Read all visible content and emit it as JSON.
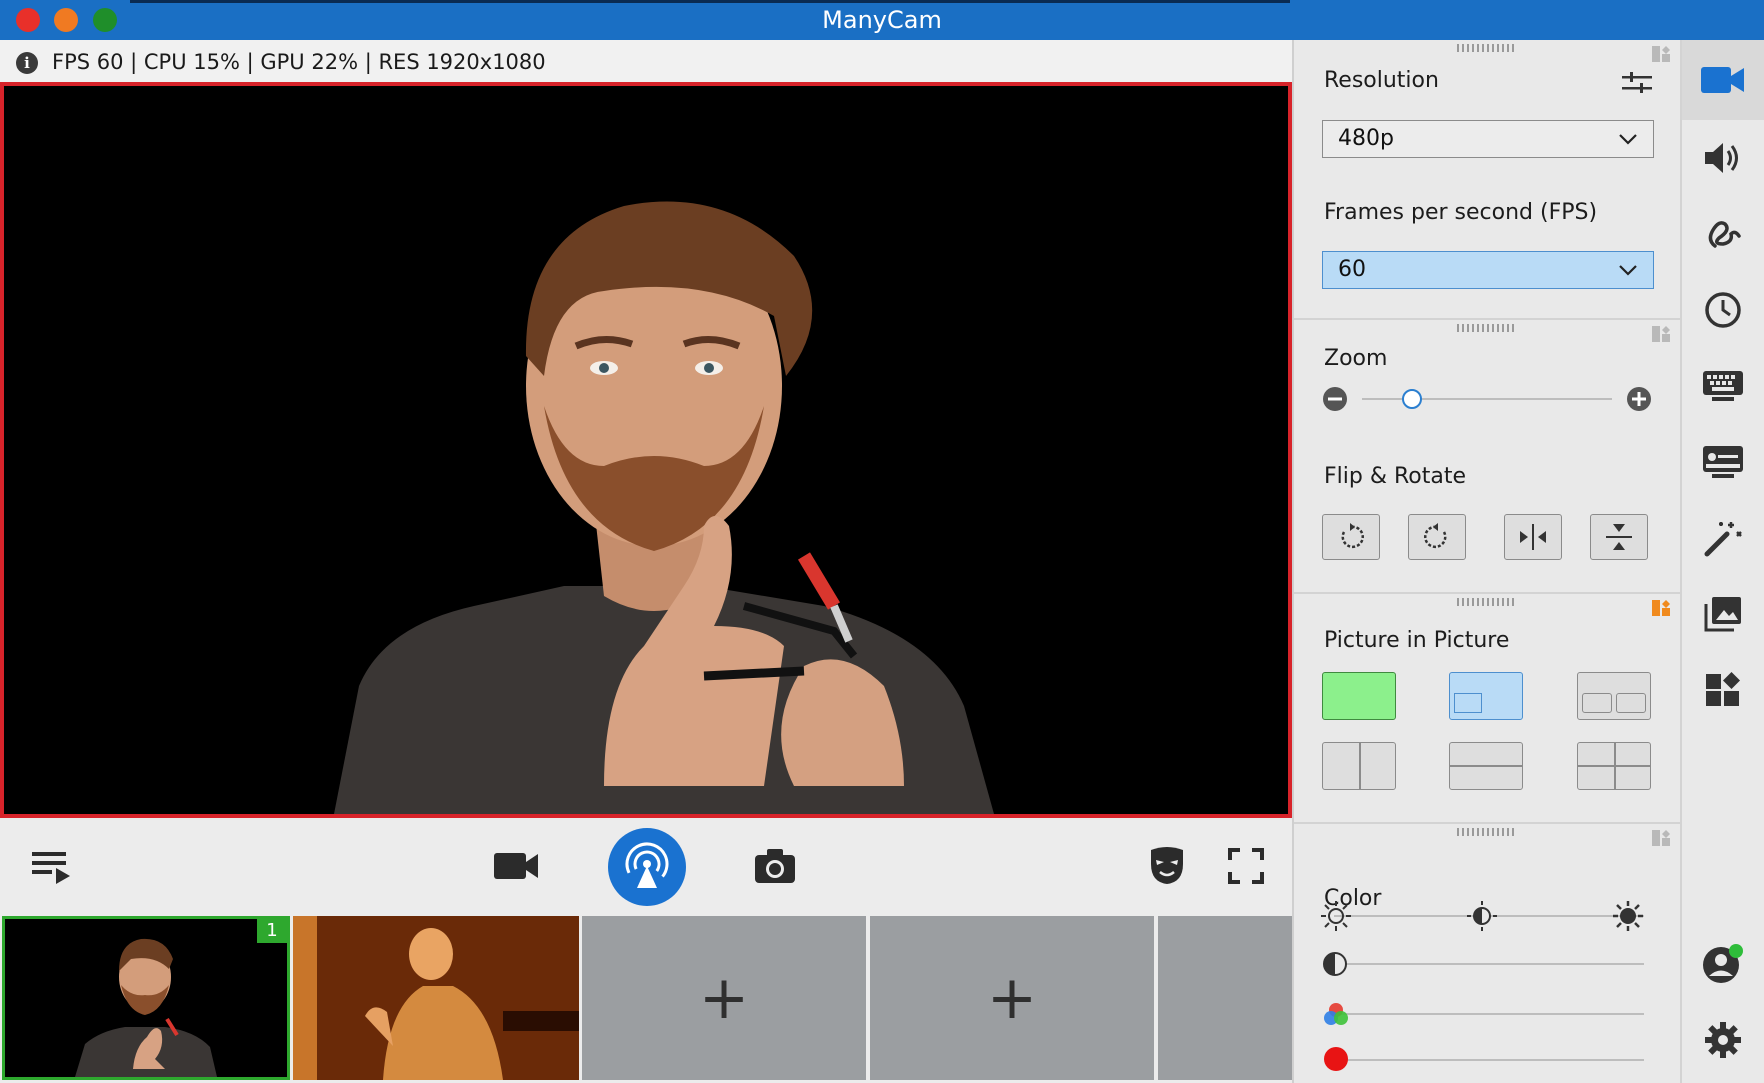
{
  "app": {
    "title": "ManyCam"
  },
  "stats": {
    "text": "FPS 60 | CPU 15% | GPU 22% | RES 1920x1080"
  },
  "colors": {
    "accent": "#1a6fc4",
    "preview_border": "#d8232a",
    "active_source": "#2ea82e",
    "selected_blue": "#b9dbf6",
    "selected_green": "#8cf08c"
  },
  "toolbar": {
    "icons": [
      "playlist-icon",
      "video-camera-icon",
      "broadcast-icon",
      "snapshot-camera-icon",
      "mask-icon",
      "fullscreen-icon"
    ]
  },
  "sources": [
    {
      "badge": "1",
      "active": true
    },
    {
      "badge": "",
      "active": false
    },
    {
      "add_label": "+"
    },
    {
      "add_label": "+"
    }
  ],
  "panel": {
    "resolution": {
      "title": "Resolution",
      "value": "480p"
    },
    "fps": {
      "title": "Frames per second (FPS)",
      "value": "60"
    },
    "zoom": {
      "title": "Zoom",
      "level": 0.2
    },
    "flip_rotate": {
      "title": "Flip & Rotate",
      "buttons": [
        "rotate-left-icon",
        "rotate-right-icon",
        "flip-horizontal-icon",
        "flip-vertical-icon"
      ]
    },
    "pip": {
      "title": "Picture in Picture",
      "layouts": [
        "single",
        "pip",
        "side-by-side-small",
        "split-vertical",
        "split-horizontal",
        "quad"
      ],
      "selected": "single"
    },
    "color": {
      "title": "Color",
      "sliders": [
        "brightness",
        "contrast",
        "saturation",
        "red"
      ]
    }
  },
  "rail": {
    "items": [
      "video-icon",
      "audio-icon",
      "scribble-icon",
      "clock-icon",
      "keyboard-icon",
      "lower-thirds-icon",
      "effects-wand-icon",
      "media-icon",
      "widgets-icon"
    ],
    "bottom": [
      "user-account-icon",
      "settings-gear-icon"
    ]
  }
}
